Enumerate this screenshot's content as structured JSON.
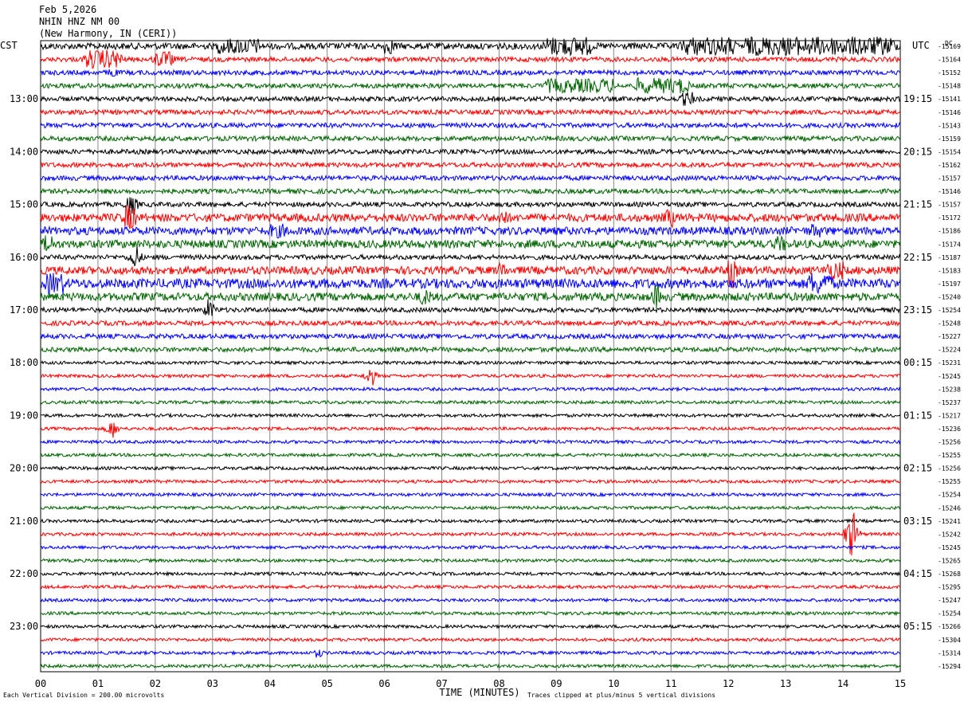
{
  "header": {
    "date": "Feb 5,2026",
    "station": "NHIN HNZ NM 00",
    "location": "(New Harmony, IN (CERI))",
    "left_zone": "CST",
    "right_zone": "UTC",
    "dc_label": "DC"
  },
  "footer": {
    "scale_note": "Each Vertical Division =  200.00 microvolts",
    "clip_note": "Traces clipped at plus/minus 5 vertical divisions"
  },
  "chart_data": {
    "type": "line",
    "xlabel": "TIME (MINUTES)",
    "xlim": [
      0,
      15
    ],
    "x_ticks": [
      "00",
      "01",
      "02",
      "03",
      "04",
      "05",
      "06",
      "07",
      "08",
      "09",
      "10",
      "11",
      "12",
      "13",
      "14",
      "15"
    ],
    "colors": [
      "#000000",
      "#ff0000",
      "#0000ff",
      "#006400"
    ],
    "left_hour_labels": [
      "13:00",
      "14:00",
      "15:00",
      "16:00",
      "17:00",
      "18:00",
      "19:00",
      "20:00",
      "21:00",
      "22:00",
      "23:00"
    ],
    "right_hour_labels": [
      "19:15",
      "20:15",
      "21:15",
      "22:15",
      "23:15",
      "00:15",
      "01:15",
      "02:15",
      "03:15",
      "04:15",
      "05:15"
    ],
    "dc_offsets": [
      "-15169",
      "-15164",
      "-15152",
      "-15148",
      "-15141",
      "-15146",
      "-15143",
      "-15159",
      "-15154",
      "-15162",
      "-15157",
      "-15146",
      "-15157",
      "-15172",
      "-15186",
      "-15174",
      "-15187",
      "-15183",
      "-15197",
      "-15240",
      "-15254",
      "-15248",
      "-15227",
      "-15224",
      "-15231",
      "-15245",
      "-15238",
      "-15237",
      "-15217",
      "-15236",
      "-15256",
      "-15255",
      "-15256",
      "-15255",
      "-15254",
      "-15246",
      "-15241",
      "-15242",
      "-15245",
      "-15265",
      "-15268",
      "-15295",
      "-15247",
      "-15254",
      "-15266",
      "-15304",
      "-15314",
      "-15294"
    ],
    "noise_levels": [
      4,
      3,
      3,
      3,
      3,
      3,
      3,
      3,
      3,
      3,
      3,
      3,
      3,
      5,
      5,
      5,
      3,
      5,
      6,
      5,
      3,
      3,
      3,
      3,
      2,
      2,
      2,
      2,
      2,
      2,
      2,
      2,
      2,
      2,
      2,
      2,
      2,
      2,
      2,
      2,
      2,
      2,
      2,
      2,
      2,
      2,
      2,
      2
    ],
    "bursts": [
      {
        "trace": 0,
        "start": 3.1,
        "end": 3.8,
        "amp": 10
      },
      {
        "trace": 0,
        "start": 8.8,
        "end": 9.6,
        "amp": 12
      },
      {
        "trace": 0,
        "start": 11.2,
        "end": 12.1,
        "amp": 12
      },
      {
        "trace": 0,
        "start": 12.3,
        "end": 14.9,
        "amp": 12
      },
      {
        "trace": 0,
        "start": 6.0,
        "end": 6.2,
        "amp": 10
      },
      {
        "trace": 1,
        "start": 0.8,
        "end": 1.4,
        "amp": 12
      },
      {
        "trace": 1,
        "start": 2.0,
        "end": 2.3,
        "amp": 10
      },
      {
        "trace": 2,
        "start": 1.2,
        "end": 1.3,
        "amp": 8
      },
      {
        "trace": 3,
        "start": 8.8,
        "end": 10.0,
        "amp": 9
      },
      {
        "trace": 3,
        "start": 10.4,
        "end": 11.3,
        "amp": 10
      },
      {
        "trace": 4,
        "start": 11.2,
        "end": 11.4,
        "amp": 9
      },
      {
        "trace": 12,
        "start": 1.5,
        "end": 1.65,
        "amp": 14
      },
      {
        "trace": 13,
        "start": 1.45,
        "end": 1.65,
        "amp": 16
      },
      {
        "trace": 13,
        "start": 8.0,
        "end": 8.15,
        "amp": 10
      },
      {
        "trace": 13,
        "start": 10.9,
        "end": 11.05,
        "amp": 12
      },
      {
        "trace": 14,
        "start": 4.0,
        "end": 4.3,
        "amp": 9
      },
      {
        "trace": 14,
        "start": 13.4,
        "end": 13.6,
        "amp": 9
      },
      {
        "trace": 15,
        "start": 0.05,
        "end": 0.2,
        "amp": 12
      },
      {
        "trace": 15,
        "start": 12.8,
        "end": 13.0,
        "amp": 10
      },
      {
        "trace": 16,
        "start": 1.6,
        "end": 1.7,
        "amp": 16
      },
      {
        "trace": 17,
        "start": 8.0,
        "end": 8.1,
        "amp": 12
      },
      {
        "trace": 17,
        "start": 12.0,
        "end": 12.1,
        "amp": 22
      },
      {
        "trace": 17,
        "start": 13.7,
        "end": 14.0,
        "amp": 12
      },
      {
        "trace": 18,
        "start": 0.1,
        "end": 0.4,
        "amp": 14
      },
      {
        "trace": 18,
        "start": 13.4,
        "end": 13.8,
        "amp": 14
      },
      {
        "trace": 19,
        "start": 10.7,
        "end": 10.8,
        "amp": 16
      },
      {
        "trace": 19,
        "start": 6.6,
        "end": 6.8,
        "amp": 10
      },
      {
        "trace": 20,
        "start": 2.9,
        "end": 3.0,
        "amp": 14
      },
      {
        "trace": 25,
        "start": 5.7,
        "end": 5.8,
        "amp": 12
      },
      {
        "trace": 29,
        "start": 1.2,
        "end": 1.3,
        "amp": 12
      },
      {
        "trace": 37,
        "start": 14.1,
        "end": 14.2,
        "amp": 28
      },
      {
        "trace": 46,
        "start": 4.8,
        "end": 4.9,
        "amp": 6
      }
    ]
  }
}
